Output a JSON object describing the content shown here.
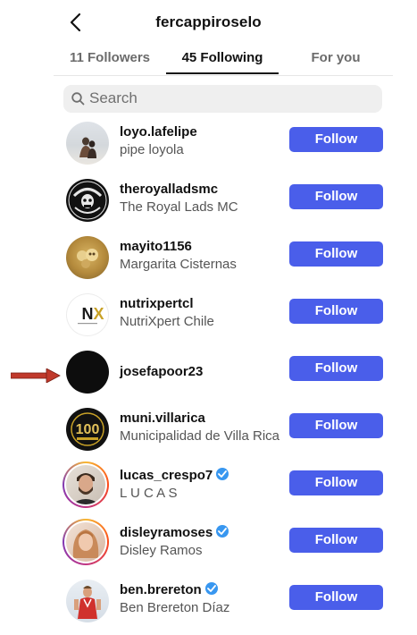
{
  "header": {
    "title": "fercappiroselo"
  },
  "tabs": [
    {
      "label": "11 Followers"
    },
    {
      "label": "45 Following"
    },
    {
      "label": "For you"
    }
  ],
  "search": {
    "placeholder": "Search"
  },
  "follow_label": "Follow",
  "users": [
    {
      "username": "loyo.lafelipe",
      "full_name": "pipe loyola",
      "verified": false
    },
    {
      "username": "theroyalladsmc",
      "full_name": "The Royal Lads MC",
      "verified": false
    },
    {
      "username": "mayito1156",
      "full_name": "Margarita Cisternas",
      "verified": false
    },
    {
      "username": "nutrixpertcl",
      "full_name": "NutriXpert Chile",
      "verified": false
    },
    {
      "username": "josefapoor23",
      "full_name": "",
      "verified": false
    },
    {
      "username": "muni.villarica",
      "full_name": "Municipalidad de Villa Rica",
      "verified": false
    },
    {
      "username": "lucas_crespo7",
      "full_name": "L U C A S",
      "verified": true
    },
    {
      "username": "disleyramoses",
      "full_name": "Disley Ramos",
      "verified": true
    },
    {
      "username": "ben.brereton",
      "full_name": "Ben Brereton Díaz",
      "verified": true
    }
  ],
  "colors": {
    "follow_button": "#4a5eea",
    "annotation_arrow": "#c0392b",
    "verified_badge": "#3897f0"
  }
}
